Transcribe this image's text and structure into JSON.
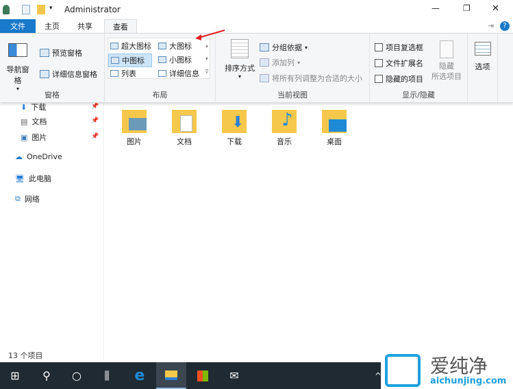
{
  "title": "Administrator",
  "window": {
    "minimize": "—",
    "restore": "❐",
    "close": "✕"
  },
  "tabs": [
    "文件",
    "主页",
    "共享",
    "查看"
  ],
  "ribbon": {
    "panes": {
      "nav": "导航窗格",
      "preview": "预览窗格",
      "details": "详细信息窗格",
      "label": "窗格"
    },
    "layout": {
      "items": [
        "超大图标",
        "大图标",
        "中图标",
        "小图标",
        "列表",
        "详细信息"
      ],
      "label": "布局",
      "selected": "中图标"
    },
    "view": {
      "sort": "排序方式",
      "group": "分组依据",
      "add_col": "添加列",
      "fit": "将所有列调整为合适的大小",
      "label": "当前视图"
    },
    "show": {
      "checkbox": "项目复选框",
      "ext": "文件扩展名",
      "hidden": "隐藏的项目",
      "hide_sel_1": "隐藏",
      "hide_sel_2": "所选项目",
      "label": "显示/隐藏"
    },
    "options": "选项"
  },
  "nav": [
    "下载",
    "文档",
    "图片",
    "OneDrive",
    "此电脑",
    "网络"
  ],
  "folders": [
    "图片",
    "文档",
    "下载",
    "音乐",
    "桌面"
  ],
  "status": "13 个项目",
  "watermark": {
    "brand": "爱纯净",
    "url": "aichunjing.com"
  },
  "colors": {
    "accent": "#1979ca",
    "taskbar": "#1f2a33"
  }
}
